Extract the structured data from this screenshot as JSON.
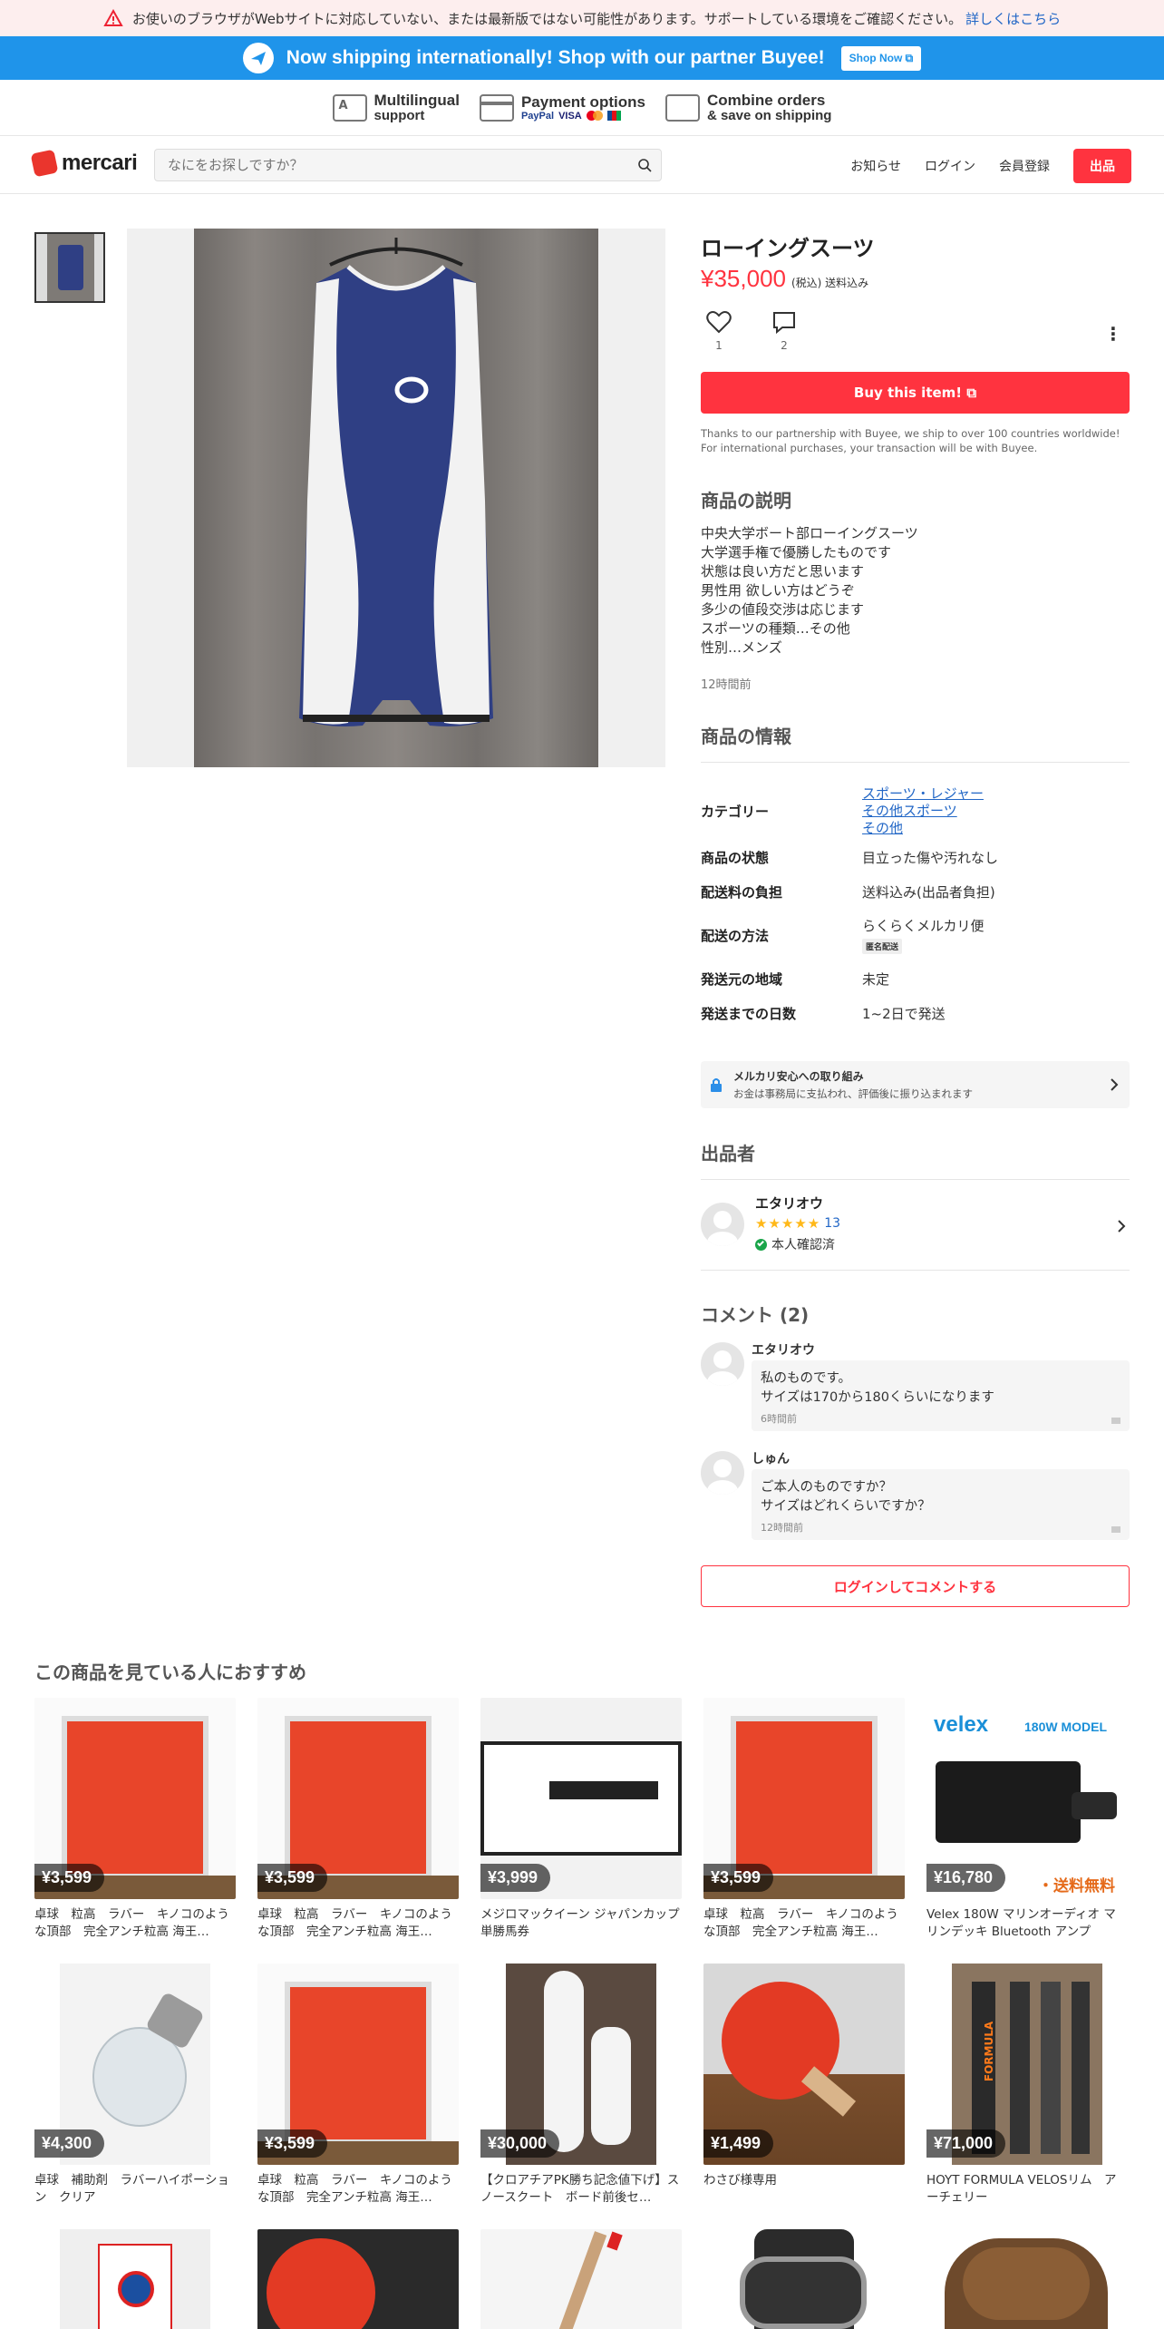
{
  "warning": {
    "text": "お使いのブラウザがWebサイトに対応していない、または最新版ではない可能性があります。サポートしている環境をご確認ください。",
    "link": "詳しくはこちら"
  },
  "buyee": {
    "message": "Now shipping internationally! Shop with our partner Buyee!",
    "button": "Shop Now"
  },
  "features": [
    {
      "line1": "Multilingual",
      "line2": "support"
    },
    {
      "line1": "Payment options",
      "logos": [
        "PayPal",
        "VISA",
        "MC",
        "JCB"
      ]
    },
    {
      "line1": "Combine orders",
      "line2": "& save on shipping"
    }
  ],
  "header": {
    "logo": "mercari",
    "search_placeholder": "なにをお探しですか？",
    "notifications": "お知らせ",
    "login": "ログイン",
    "signup": "会員登録",
    "sell": "出品"
  },
  "product": {
    "title": "ローイングスーツ",
    "price": "¥35,000",
    "price_note": "(税込) 送料込み",
    "likes": "1",
    "comments_count": "2",
    "buy_button": "Buy this item!",
    "buy_note": "Thanks to our partnership with Buyee, we ship to over 100 countries worldwide! For international purchases, your transaction will be with Buyee.",
    "desc_heading": "商品の説明",
    "description": "中央大学ボート部ローイングスーツ\n大学選手権で優勝したものです\n状態は良い方だと思います\n男性用  欲しい方はどうぞ\n多少の値段交渉は応じます\nスポーツの種類…その他\n性別…メンズ",
    "posted": "12時間前",
    "info_heading": "商品の情報",
    "info": {
      "category_label": "カテゴリー",
      "category": [
        "スポーツ・レジャー",
        "その他スポーツ",
        "その他"
      ],
      "condition_label": "商品の状態",
      "condition": "目立った傷や汚れなし",
      "shipping_fee_label": "配送料の負担",
      "shipping_fee": "送料込み(出品者負担)",
      "method_label": "配送の方法",
      "method": "らくらくメルカリ便",
      "method_badge": "匿名配送",
      "origin_label": "発送元の地域",
      "origin": "未定",
      "days_label": "発送までの日数",
      "days": "1~2日で発送"
    },
    "safety_title": "メルカリ安心への取り組み",
    "safety_sub": "お金は事務局に支払われ、評価後に振り込まれます"
  },
  "seller": {
    "heading": "出品者",
    "name": "エタリオウ",
    "rating": 5,
    "reviews": "13",
    "verified": "本人確認済"
  },
  "comments": {
    "heading": "コメント (2)",
    "items": [
      {
        "user": "エタリオウ",
        "text": "私のものです。\nサイズは170から180くらいになります",
        "time": "6時間前"
      },
      {
        "user": "しゅん",
        "text": "ご本人のものですか？\nサイズはどれくらいですか？",
        "time": "12時間前"
      }
    ],
    "login_button": "ログインしてコメントする"
  },
  "recommend": {
    "heading": "この商品を見ている人におすすめ",
    "items": [
      {
        "price": "¥3,599",
        "name": "卓球　粒高　ラバー　キノコのような頂部　完全アンチ粒高 海王…",
        "kind": "rubber"
      },
      {
        "price": "¥3,599",
        "name": "卓球　粒高　ラバー　キノコのような頂部　完全アンチ粒高 海王…",
        "kind": "rubber"
      },
      {
        "price": "¥3,999",
        "name": "メジロマックイーン ジャパンカップ 単勝馬券",
        "kind": "ticket"
      },
      {
        "price": "¥3,599",
        "name": "卓球　粒高　ラバー　キノコのような頂部　完全アンチ粒高 海王…",
        "kind": "rubber"
      },
      {
        "price": "¥16,780",
        "name": "Velex 180W マリンオーディオ マリンデッキ Bluetooth アンプ",
        "kind": "velex",
        "banner": "velex",
        "model": "180W MODEL",
        "overlay": "・送料無料"
      },
      {
        "price": "¥4,300",
        "name": "卓球　補助剤　ラバーハイポーション　クリア",
        "kind": "bottle"
      },
      {
        "price": "¥3,599",
        "name": "卓球　粒高　ラバー　キノコのような頂部　完全アンチ粒高 海王…",
        "kind": "rubber"
      },
      {
        "price": "¥30,000",
        "name": "【クロアチアPK勝ち記念値下げ】スノースクート　ボード前後セ…",
        "kind": "board"
      },
      {
        "price": "¥1,499",
        "name": "わさび様専用",
        "kind": "paddle"
      },
      {
        "price": "¥71,000",
        "name": "HOYT FORMULA VELOSリム　アーチェリー",
        "kind": "hoyt",
        "label": "FORMULA"
      }
    ]
  },
  "colors": {
    "accent": "#ff333f",
    "buyee": "#1f94ea",
    "link": "#2166c6"
  }
}
